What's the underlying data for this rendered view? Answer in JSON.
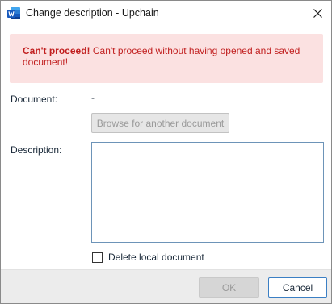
{
  "window": {
    "title": "Change description - Upchain",
    "app_icon": "word-icon",
    "close_icon": "close-icon"
  },
  "alert": {
    "title": "Can't proceed!",
    "message": "Can't proceed without having opened and saved document!",
    "color": "#c11f1f",
    "background": "#fbe1e1"
  },
  "form": {
    "document_label": "Document:",
    "document_value": "-",
    "browse_button_label": "Browse for another document",
    "description_label": "Description:",
    "description_value": "",
    "delete_local_label": "Delete local document",
    "delete_local_checked": false
  },
  "footer": {
    "ok_label": "OK",
    "cancel_label": "Cancel"
  }
}
